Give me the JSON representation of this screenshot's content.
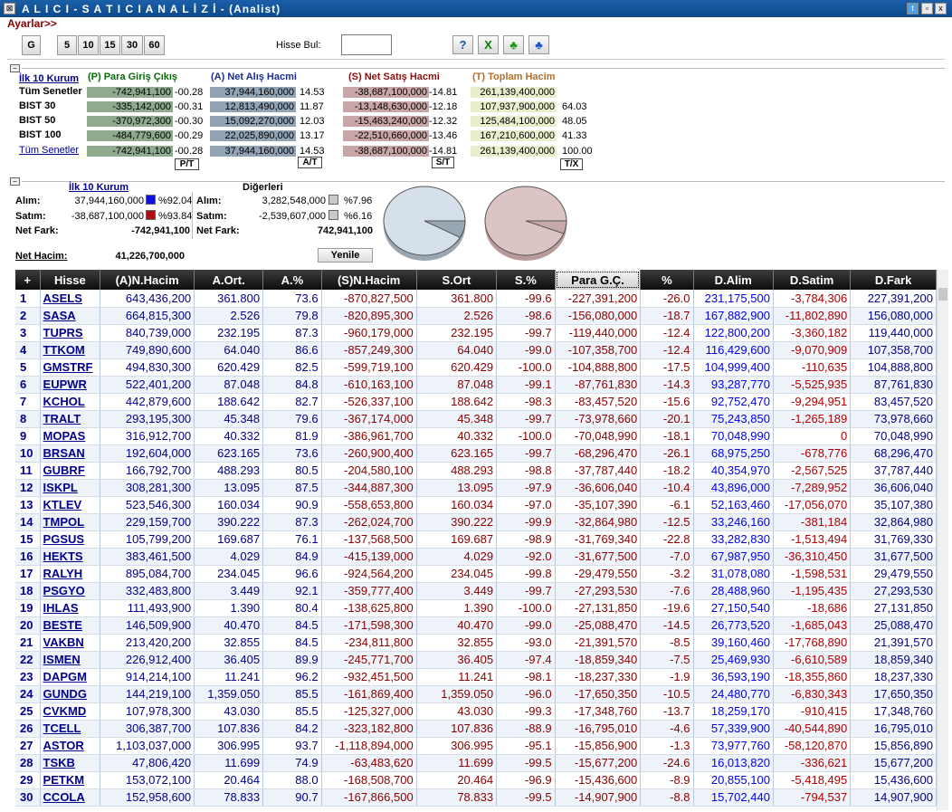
{
  "window": {
    "title": "A L I C I  -  S A T I C I   A N A L İ Z İ  - (Analist)",
    "min": "_",
    "restore": "▫",
    "close": "x",
    "sys": "⊠"
  },
  "settings_link": "Ayarlar>>",
  "periods": [
    "G",
    "5",
    "10",
    "15",
    "30",
    "60"
  ],
  "search": {
    "label": "Hisse Bul:",
    "value": ""
  },
  "icons": {
    "help": "?",
    "excel": "X",
    "group_green": "♣",
    "group_blue": "♣"
  },
  "top": {
    "link": "İlk 10 Kurum",
    "col_p": "(P) Para Giriş Çıkış",
    "col_a": "(A) Net Alış Hacmi",
    "col_s": "(S) Net Satış Hacmi",
    "col_t": "(T) Toplam Hacim",
    "colors": {
      "p": "#0a6a0a",
      "a": "#1a2e8a",
      "s": "#8b1010",
      "t": "#b07030"
    },
    "rows": [
      {
        "label": "Tüm Senetler",
        "p": "-742,941,100",
        "p_pct": "-00.28",
        "a": "37,944,160,000",
        "a_pct": "14.53",
        "s": "-38,687,100,000",
        "s_pct": "-14.81",
        "t": "261,139,400,000",
        "t_pct": ""
      },
      {
        "label": "BIST 30",
        "p": "-335,142,000",
        "p_pct": "-00.31",
        "a": "12,813,490,000",
        "a_pct": "11.87",
        "s": "-13,148,630,000",
        "s_pct": "-12.18",
        "t": "107,937,900,000",
        "t_pct": "64.03"
      },
      {
        "label": "BIST 50",
        "p": "-370,972,300",
        "p_pct": "-00.30",
        "a": "15,092,270,000",
        "a_pct": "12.03",
        "s": "-15,463,240,000",
        "s_pct": "-12.32",
        "t": "125,484,100,000",
        "t_pct": "48.05"
      },
      {
        "label": "BIST 100",
        "p": "-484,779,600",
        "p_pct": "-00.29",
        "a": "22,025,890,000",
        "a_pct": "13.17",
        "s": "-22,510,660,000",
        "s_pct": "-13.46",
        "t": "167,210,600,000",
        "t_pct": "41.33"
      },
      {
        "label": "Tüm Senetler",
        "p": "-742,941,100",
        "p_pct": "-00.28",
        "a": "37,944,160,000",
        "a_pct": "14.53",
        "s": "-38,687,100,000",
        "s_pct": "-14.81",
        "t": "261,139,400,000",
        "t_pct": "100.00"
      }
    ],
    "buttons": {
      "pt": "P/T",
      "at": "A/T",
      "st": "S/T",
      "tx": "T/X"
    }
  },
  "mid": {
    "title_link": "İlk 10 Kurum",
    "title_other": "Diğerleri",
    "alim_label": "Alım:",
    "satim_label": "Satım:",
    "netfark_label": "Net Fark:",
    "alim": "37,944,160,000",
    "alim_pct": "%92.04",
    "satim": "-38,687,100,000",
    "satim_pct": "%93.84",
    "netfark": "-742,941,100",
    "o_alim": "3,282,548,000",
    "o_alim_pct": "%7.96",
    "o_satim": "-2,539,607,000",
    "o_satim_pct": "%6.16",
    "o_netfark": "742,941,100",
    "net_hacim_label": "Net Hacim:",
    "net_hacim": "41,226,700,000",
    "refresh": "Yenile",
    "colors": {
      "blue_sq": "#1010dd",
      "red_sq": "#aa1010",
      "grey_sq": "#c8c8c8"
    },
    "pie_buy_share": 0.92,
    "pie_sell_share": 0.94
  },
  "table": {
    "headers": [
      "+",
      "Hisse",
      "(A)N.Hacim",
      "A.Ort.",
      "A.%",
      "(S)N.Hacim",
      "S.Ort",
      "S.%",
      "Para G.Ç.",
      "%",
      "D.Alim",
      "D.Satim",
      "D.Fark"
    ],
    "rows": [
      [
        "1",
        "ASELS",
        "643,436,200",
        "361.800",
        "73.6",
        "-870,827,500",
        "361.800",
        "-99.6",
        "-227,391,200",
        "-26.0",
        "231,175,500",
        "-3,784,306",
        "227,391,200"
      ],
      [
        "2",
        "SASA",
        "664,815,300",
        "2.526",
        "79.8",
        "-820,895,300",
        "2.526",
        "-98.6",
        "-156,080,000",
        "-18.7",
        "167,882,900",
        "-11,802,890",
        "156,080,000"
      ],
      [
        "3",
        "TUPRS",
        "840,739,000",
        "232.195",
        "87.3",
        "-960,179,000",
        "232.195",
        "-99.7",
        "-119,440,000",
        "-12.4",
        "122,800,200",
        "-3,360,182",
        "119,440,000"
      ],
      [
        "4",
        "TTKOM",
        "749,890,600",
        "64.040",
        "86.6",
        "-857,249,300",
        "64.040",
        "-99.0",
        "-107,358,700",
        "-12.4",
        "116,429,600",
        "-9,070,909",
        "107,358,700"
      ],
      [
        "5",
        "GMSTRF",
        "494,830,300",
        "620.429",
        "82.5",
        "-599,719,100",
        "620.429",
        "-100.0",
        "-104,888,800",
        "-17.5",
        "104,999,400",
        "-110,635",
        "104,888,800"
      ],
      [
        "6",
        "EUPWR",
        "522,401,200",
        "87.048",
        "84.8",
        "-610,163,100",
        "87.048",
        "-99.1",
        "-87,761,830",
        "-14.3",
        "93,287,770",
        "-5,525,935",
        "87,761,830"
      ],
      [
        "7",
        "KCHOL",
        "442,879,600",
        "188.642",
        "82.7",
        "-526,337,100",
        "188.642",
        "-98.3",
        "-83,457,520",
        "-15.6",
        "92,752,470",
        "-9,294,951",
        "83,457,520"
      ],
      [
        "8",
        "TRALT",
        "293,195,300",
        "45.348",
        "79.6",
        "-367,174,000",
        "45.348",
        "-99.7",
        "-73,978,660",
        "-20.1",
        "75,243,850",
        "-1,265,189",
        "73,978,660"
      ],
      [
        "9",
        "MOPAS",
        "316,912,700",
        "40.332",
        "81.9",
        "-386,961,700",
        "40.332",
        "-100.0",
        "-70,048,990",
        "-18.1",
        "70,048,990",
        "0",
        "70,048,990"
      ],
      [
        "10",
        "BRSAN",
        "192,604,000",
        "623.165",
        "73.6",
        "-260,900,400",
        "623.165",
        "-99.7",
        "-68,296,470",
        "-26.1",
        "68,975,250",
        "-678,776",
        "68,296,470"
      ],
      [
        "11",
        "GUBRF",
        "166,792,700",
        "488.293",
        "80.5",
        "-204,580,100",
        "488.293",
        "-98.8",
        "-37,787,440",
        "-18.2",
        "40,354,970",
        "-2,567,525",
        "37,787,440"
      ],
      [
        "12",
        "ISKPL",
        "308,281,300",
        "13.095",
        "87.5",
        "-344,887,300",
        "13.095",
        "-97.9",
        "-36,606,040",
        "-10.4",
        "43,896,000",
        "-7,289,952",
        "36,606,040"
      ],
      [
        "13",
        "KTLEV",
        "523,546,300",
        "160.034",
        "90.9",
        "-558,653,800",
        "160.034",
        "-97.0",
        "-35,107,390",
        "-6.1",
        "52,163,460",
        "-17,056,070",
        "35,107,380"
      ],
      [
        "14",
        "TMPOL",
        "229,159,700",
        "390.222",
        "87.3",
        "-262,024,700",
        "390.222",
        "-99.9",
        "-32,864,980",
        "-12.5",
        "33,246,160",
        "-381,184",
        "32,864,980"
      ],
      [
        "15",
        "PGSUS",
        "105,799,200",
        "169.687",
        "76.1",
        "-137,568,500",
        "169.687",
        "-98.9",
        "-31,769,340",
        "-22.8",
        "33,282,830",
        "-1,513,494",
        "31,769,330"
      ],
      [
        "16",
        "HEKTS",
        "383,461,500",
        "4.029",
        "84.9",
        "-415,139,000",
        "4.029",
        "-92.0",
        "-31,677,500",
        "-7.0",
        "67,987,950",
        "-36,310,450",
        "31,677,500"
      ],
      [
        "17",
        "RALYH",
        "895,084,700",
        "234.045",
        "96.6",
        "-924,564,200",
        "234.045",
        "-99.8",
        "-29,479,550",
        "-3.2",
        "31,078,080",
        "-1,598,531",
        "29,479,550"
      ],
      [
        "18",
        "PSGYO",
        "332,483,800",
        "3.449",
        "92.1",
        "-359,777,400",
        "3.449",
        "-99.7",
        "-27,293,530",
        "-7.6",
        "28,488,960",
        "-1,195,435",
        "27,293,530"
      ],
      [
        "19",
        "IHLAS",
        "111,493,900",
        "1.390",
        "80.4",
        "-138,625,800",
        "1.390",
        "-100.0",
        "-27,131,850",
        "-19.6",
        "27,150,540",
        "-18,686",
        "27,131,850"
      ],
      [
        "20",
        "BESTE",
        "146,509,900",
        "40.470",
        "84.5",
        "-171,598,300",
        "40.470",
        "-99.0",
        "-25,088,470",
        "-14.5",
        "26,773,520",
        "-1,685,043",
        "25,088,470"
      ],
      [
        "21",
        "VAKBN",
        "213,420,200",
        "32.855",
        "84.5",
        "-234,811,800",
        "32.855",
        "-93.0",
        "-21,391,570",
        "-8.5",
        "39,160,460",
        "-17,768,890",
        "21,391,570"
      ],
      [
        "22",
        "ISMEN",
        "226,912,400",
        "36.405",
        "89.9",
        "-245,771,700",
        "36.405",
        "-97.4",
        "-18,859,340",
        "-7.5",
        "25,469,930",
        "-6,610,589",
        "18,859,340"
      ],
      [
        "23",
        "DAPGM",
        "914,214,100",
        "11.241",
        "96.2",
        "-932,451,500",
        "11.241",
        "-98.1",
        "-18,237,330",
        "-1.9",
        "36,593,190",
        "-18,355,860",
        "18,237,330"
      ],
      [
        "24",
        "GUNDG",
        "144,219,100",
        "1,359.050",
        "85.5",
        "-161,869,400",
        "1,359.050",
        "-96.0",
        "-17,650,350",
        "-10.5",
        "24,480,770",
        "-6,830,343",
        "17,650,350"
      ],
      [
        "25",
        "CVKMD",
        "107,978,300",
        "43.030",
        "85.5",
        "-125,327,000",
        "43.030",
        "-99.3",
        "-17,348,760",
        "-13.7",
        "18,259,170",
        "-910,415",
        "17,348,760"
      ],
      [
        "26",
        "TCELL",
        "306,387,700",
        "107.836",
        "84.2",
        "-323,182,800",
        "107.836",
        "-88.9",
        "-16,795,010",
        "-4.6",
        "57,339,900",
        "-40,544,890",
        "16,795,010"
      ],
      [
        "27",
        "ASTOR",
        "1,103,037,000",
        "306.995",
        "93.7",
        "-1,118,894,000",
        "306.995",
        "-95.1",
        "-15,856,900",
        "-1.3",
        "73,977,760",
        "-58,120,870",
        "15,856,890"
      ],
      [
        "28",
        "TSKB",
        "47,806,420",
        "11.699",
        "74.9",
        "-63,483,620",
        "11.699",
        "-99.5",
        "-15,677,200",
        "-24.6",
        "16,013,820",
        "-336,621",
        "15,677,200"
      ],
      [
        "29",
        "PETKM",
        "153,072,100",
        "20.464",
        "88.0",
        "-168,508,700",
        "20.464",
        "-96.9",
        "-15,436,600",
        "-8.9",
        "20,855,100",
        "-5,418,495",
        "15,436,600"
      ],
      [
        "30",
        "CCOLA",
        "152,958,600",
        "78.833",
        "90.7",
        "-167,866,500",
        "78.833",
        "-99.5",
        "-14,907,900",
        "-8.8",
        "15,702,440",
        "-794,537",
        "14,907,900"
      ]
    ]
  }
}
